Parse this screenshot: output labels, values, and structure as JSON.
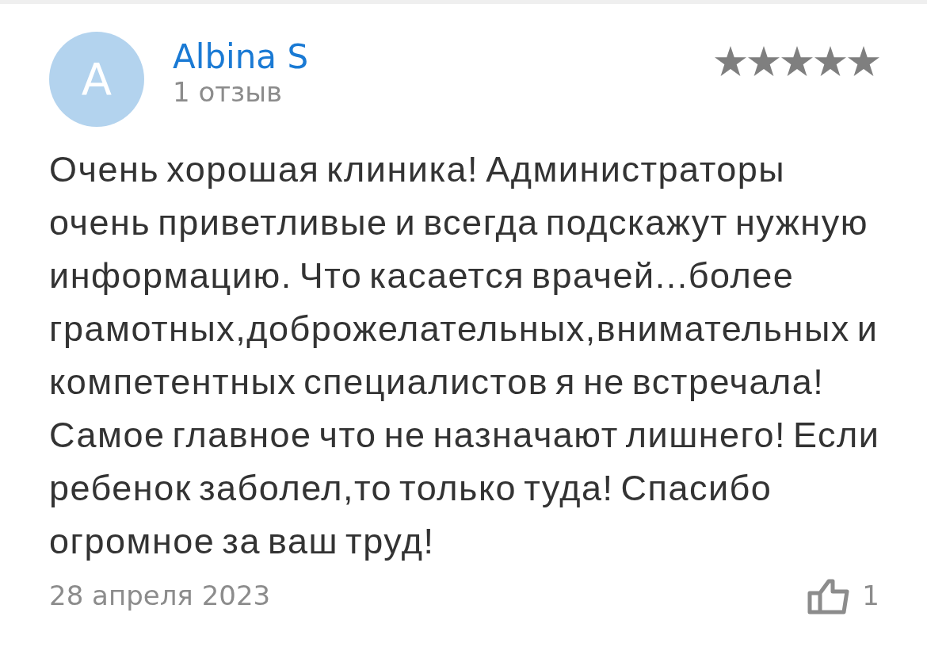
{
  "review": {
    "author": {
      "initial": "A",
      "name": "Albina S",
      "review_count": "1 отзыв"
    },
    "stars": 5,
    "text": "Очень хорошая клиника! Администраторы очень приветливые и всегда подскажут нужную информацию. Что касается врачей...более грамотных,доброжелательных,внимательных и компетентных специалистов я не встречала! Самое главное что не назначают лишнего! Если ребенок заболел,то только туда! Спасибо огромное за ваш труд!",
    "date": "28 апреля 2023",
    "likes": "1"
  }
}
